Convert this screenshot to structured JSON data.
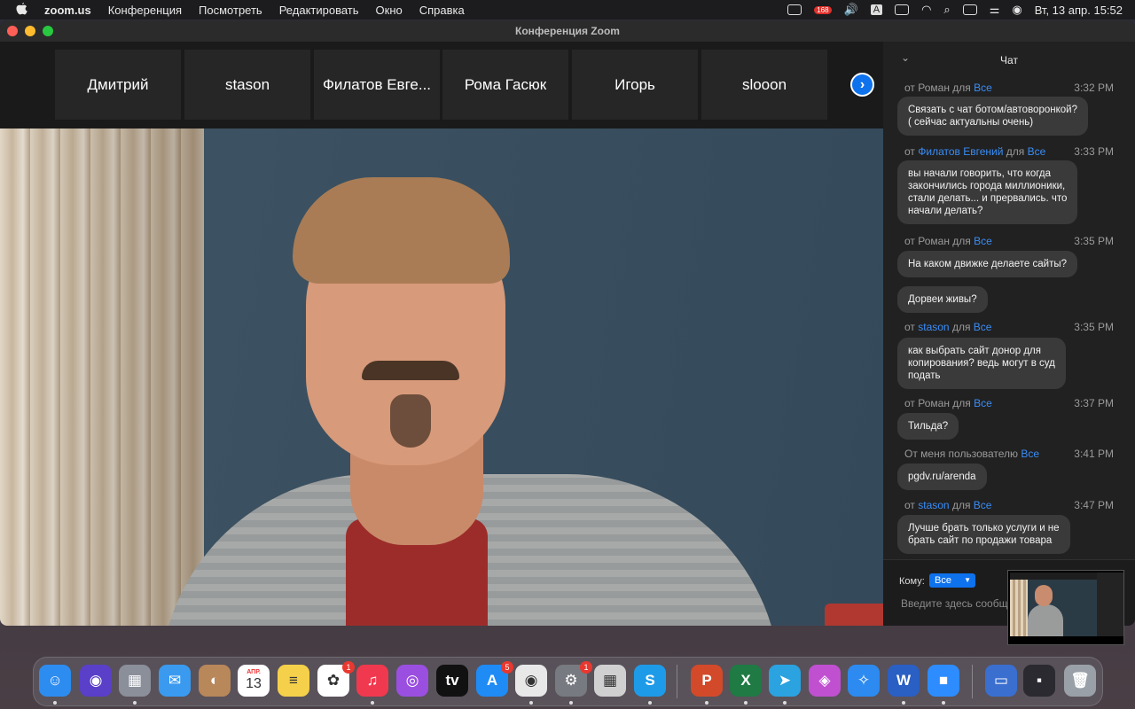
{
  "menubar": {
    "apple_icon": "apple-logo-icon",
    "items": [
      "zoom.us",
      "Конференция",
      "Посмотреть",
      "Редактировать",
      "Окно",
      "Справка"
    ],
    "badge": "168",
    "input_lang": "A",
    "clock": "Вт, 13 апр.  15:52"
  },
  "window": {
    "title": "Конференция Zoom"
  },
  "participants": [
    "Дмитрий",
    "stason",
    "Филатов Евге...",
    "Рома Гасюк",
    "Игорь",
    "slooon"
  ],
  "next_button": "›",
  "chat": {
    "title": "Чат",
    "collapse": "⌄",
    "messages": [
      {
        "from_prefix": "от",
        "sender": "Роман",
        "to_prefix": "для",
        "to": "Все",
        "time": "3:32 PM",
        "text": "Связать с чат ботом/автоворонкой?\n( сейчас актуальны очень)",
        "sender_blue": false
      },
      {
        "from_prefix": "от",
        "sender": "Филатов Евгений",
        "to_prefix": "для",
        "to": "Все",
        "time": "3:33 PM",
        "text": "вы начали говорить,  что когда\nзакончились города миллионики,\nстали делать... и прервались. что\nначали делать?",
        "sender_blue": true
      },
      {
        "from_prefix": "от",
        "sender": "Роман",
        "to_prefix": "для",
        "to": "Все",
        "time": "3:35 PM",
        "text": "На каком движке делаете сайты?",
        "sender_blue": false
      },
      {
        "text": "Дорвеи живы?"
      },
      {
        "from_prefix": "от",
        "sender": "stason",
        "to_prefix": "для",
        "to": "Все",
        "time": "3:35 PM",
        "text": "как выбрать сайт донор для\nкопирования? ведь могут в суд\nподать",
        "sender_blue": true
      },
      {
        "from_prefix": "от",
        "sender": "Роман",
        "to_prefix": "для",
        "to": "Все",
        "time": "3:37 PM",
        "text": "Тильда?",
        "sender_blue": false
      },
      {
        "from_prefix": "От меня пользователю",
        "to": "Все",
        "time": "3:41 PM",
        "text": "pgdv.ru/arenda"
      },
      {
        "from_prefix": "от",
        "sender": "stason",
        "to_prefix": "для",
        "to": "Все",
        "time": "3:47 PM",
        "text": "Лучше брать только услуги и не\nбрать сайт по продажи товара",
        "sender_blue": true
      }
    ],
    "to_label": "Кому:",
    "to_value": "Все",
    "input_placeholder": "Введите здесь сообщ"
  },
  "dock": {
    "apps": [
      {
        "name": "finder",
        "label": "☺",
        "color": "#2d8cf0"
      },
      {
        "name": "siri",
        "label": "◉",
        "color": "#5a3fc8"
      },
      {
        "name": "launchpad",
        "label": "▦",
        "color": "#8a8f9a"
      },
      {
        "name": "mail",
        "label": "✉",
        "color": "#3a9af0"
      },
      {
        "name": "contacts",
        "label": "◐",
        "color": "#b8875a"
      },
      {
        "name": "calendar",
        "label": "13",
        "color": "#ffffff",
        "sub": "АПР."
      },
      {
        "name": "notes",
        "label": "≡",
        "color": "#f5d04a"
      },
      {
        "name": "photos",
        "label": "✿",
        "color": "#ffffff",
        "badge": "1"
      },
      {
        "name": "music",
        "label": "♫",
        "color": "#f0394e"
      },
      {
        "name": "podcasts",
        "label": "◎",
        "color": "#9a4fe0"
      },
      {
        "name": "apple-tv",
        "label": "tv",
        "color": "#111111"
      },
      {
        "name": "app-store",
        "label": "A",
        "color": "#1f8bf5",
        "badge": "5"
      },
      {
        "name": "chrome",
        "label": "◉",
        "color": "#e8e8e8"
      },
      {
        "name": "system-preferences",
        "label": "⚙",
        "color": "#777a80",
        "badge": "1"
      },
      {
        "name": "calculator",
        "label": "▦",
        "color": "#d0d0d0"
      },
      {
        "name": "skype",
        "label": "S",
        "color": "#1e9be8"
      },
      {
        "name": "powerpoint",
        "label": "P",
        "color": "#d24a2a"
      },
      {
        "name": "excel",
        "label": "X",
        "color": "#1f7a44"
      },
      {
        "name": "telegram",
        "label": "➤",
        "color": "#2aa3e0"
      },
      {
        "name": "colorsnapper",
        "label": "◈",
        "color": "#c050d0"
      },
      {
        "name": "safari",
        "label": "✧",
        "color": "#2c8af0"
      },
      {
        "name": "word",
        "label": "W",
        "color": "#2a5fc4"
      },
      {
        "name": "zoom",
        "label": "■",
        "color": "#2d8cff"
      },
      {
        "name": "screenshot-folder",
        "label": "▭",
        "color": "#3a6fd0"
      },
      {
        "name": "recent-screenshot",
        "label": "▪",
        "color": "#2a2a30"
      },
      {
        "name": "trash",
        "label": "🗑",
        "color": "#9aa0a8"
      }
    ]
  }
}
